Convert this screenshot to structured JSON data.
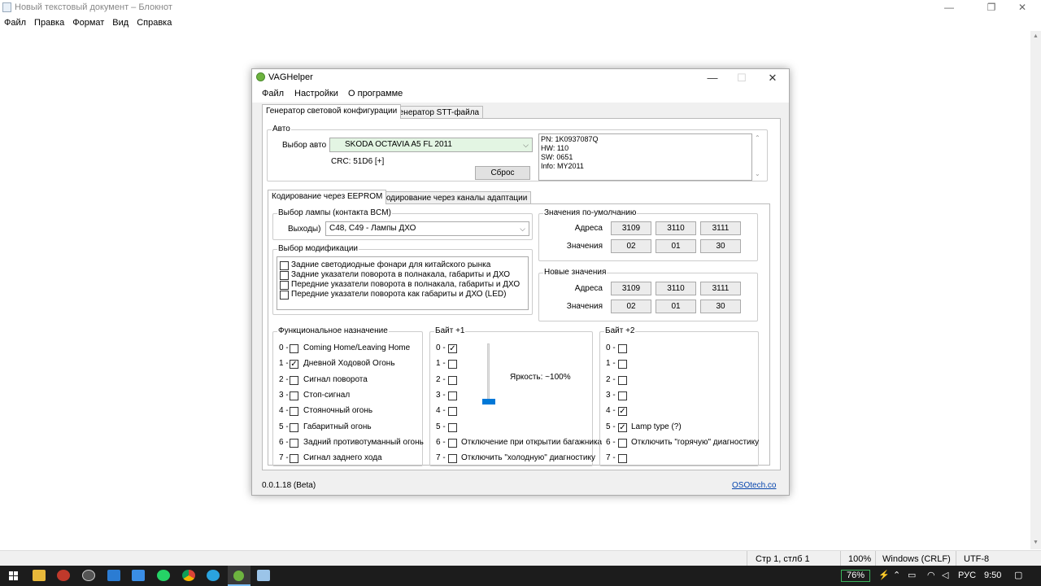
{
  "notepad": {
    "title": "Новый текстовый документ – Блокнот",
    "menu": [
      "Файл",
      "Правка",
      "Формат",
      "Вид",
      "Справка"
    ],
    "status": {
      "position": "Стр 1, стлб 1",
      "zoom": "100%",
      "line_endings": "Windows (CRLF)",
      "encoding": "UTF-8"
    }
  },
  "app": {
    "title": "VAGHelper",
    "menu": [
      "Файл",
      "Настройки",
      "О программе"
    ],
    "tabs": [
      "Генератор световой конфигурации",
      "Генератор STT-файла"
    ],
    "auto_group": "Авто",
    "car_label": "Выбор авто",
    "car_value": "SKODA OCTAVIA A5 FL 2011",
    "crc": "CRC: 51D6 [+]",
    "reset_label": "Сброс",
    "info": [
      "PN: 1K0937087Q",
      "HW: 110",
      "SW: 0651",
      "Info: MY2011"
    ],
    "subtabs": [
      "Кодирование через EEPROM",
      "Кодирование через каналы адаптации"
    ],
    "lamp_group": "Выбор лампы (контакта BCM)",
    "outputs_label": "Выходы)",
    "outputs_value": "C48, C49 - Лампы ДХО",
    "mod_group": "Выбор модификации",
    "mods": [
      "Задние светодиодные фонари для китайского рынка",
      "Задние указатели поворота в полнакала, габариты и ДХО",
      "Передние указатели поворота в полнакала, габариты и ДХО",
      "Передние указатели поворота как габариты и ДХО (LED)"
    ],
    "defaults_group": "Значения по-умолчанию",
    "new_group": "Новые значения",
    "addr_label": "Адреса",
    "val_label": "Значения",
    "default_addr": [
      "3109",
      "3110",
      "3111"
    ],
    "default_vals": [
      "02",
      "01",
      "30"
    ],
    "new_addr": [
      "3109",
      "3110",
      "3111"
    ],
    "new_vals": [
      "02",
      "01",
      "30"
    ],
    "func_group": "Функциональное назначение",
    "func": [
      {
        "idx": "0 -",
        "label": "Coming Home/Leaving Home",
        "checked": false
      },
      {
        "idx": "1 -",
        "label": "Дневной Ходовой Огонь",
        "checked": true
      },
      {
        "idx": "2 -",
        "label": "Сигнал поворота",
        "checked": false
      },
      {
        "idx": "3 -",
        "label": "Стоп-сигнал",
        "checked": false
      },
      {
        "idx": "4 -",
        "label": "Стояночный огонь",
        "checked": false
      },
      {
        "idx": "5 -",
        "label": "Габаритный огонь",
        "checked": false
      },
      {
        "idx": "6 -",
        "label": "Задний противотуманный огонь",
        "checked": false
      },
      {
        "idx": "7 -",
        "label": "Сигнал заднего хода",
        "checked": false
      }
    ],
    "b1_group": "Байт +1",
    "b1": [
      {
        "idx": "0 -",
        "label": "",
        "checked": true
      },
      {
        "idx": "1 -",
        "label": "",
        "checked": false
      },
      {
        "idx": "2 -",
        "label": "",
        "checked": false
      },
      {
        "idx": "3 -",
        "label": "",
        "checked": false
      },
      {
        "idx": "4 -",
        "label": "",
        "checked": false
      },
      {
        "idx": "5 -",
        "label": "",
        "checked": false
      },
      {
        "idx": "6 -",
        "label": "Отключение при открытии багажника",
        "checked": false
      },
      {
        "idx": "7 -",
        "label": "Отключить \"холодную\" диагностику",
        "checked": false
      }
    ],
    "brightness": "Яркость: ~100%",
    "brightness_level": 1.0,
    "b2_group": "Байт +2",
    "b2": [
      {
        "idx": "0 -",
        "label": "",
        "checked": false
      },
      {
        "idx": "1 -",
        "label": "",
        "checked": false
      },
      {
        "idx": "2 -",
        "label": "",
        "checked": false
      },
      {
        "idx": "3 -",
        "label": "",
        "checked": false
      },
      {
        "idx": "4 -",
        "label": "",
        "checked": true
      },
      {
        "idx": "5 -",
        "label": "Lamp type (?)",
        "checked": true
      },
      {
        "idx": "6 -",
        "label": "Отключить \"горячую\" диагностику",
        "checked": false
      },
      {
        "idx": "7 -",
        "label": "",
        "checked": false
      }
    ],
    "version": "0.0.1.18 (Beta)",
    "link": "OSOtech.co"
  },
  "tray": {
    "battery": "76%",
    "lang": "РУС",
    "time": "9:50"
  },
  "colors": {
    "accent": "#0078d7",
    "combo_highlight": "#e3f5e3"
  }
}
